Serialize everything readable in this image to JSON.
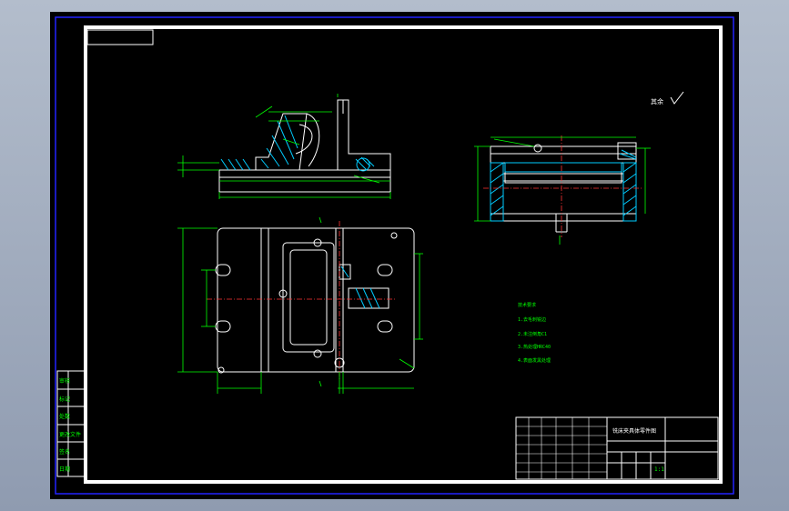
{
  "colors": {
    "background": "#000000",
    "frame": "#ffffff",
    "outer_frame": "#1a1aff",
    "geometry": "#ffffff",
    "dimension": "#00ff00",
    "centerline": "#ff3333",
    "hatch": "#00ccff",
    "text": "#ffffff"
  },
  "drawing": {
    "roughness_note": "其余",
    "notes_title": "技术要求",
    "notes": [
      "1.去毛刺锐边",
      "2.未注倒角C1",
      "3.热处理HRC40",
      "4.表面发黑处理"
    ],
    "title_block": {
      "part_name": "铣床夹具体零件图",
      "scale": "1:1"
    },
    "left_strip": [
      "审核",
      "标记",
      "处数",
      "更改文件",
      "签名",
      "日期"
    ]
  }
}
